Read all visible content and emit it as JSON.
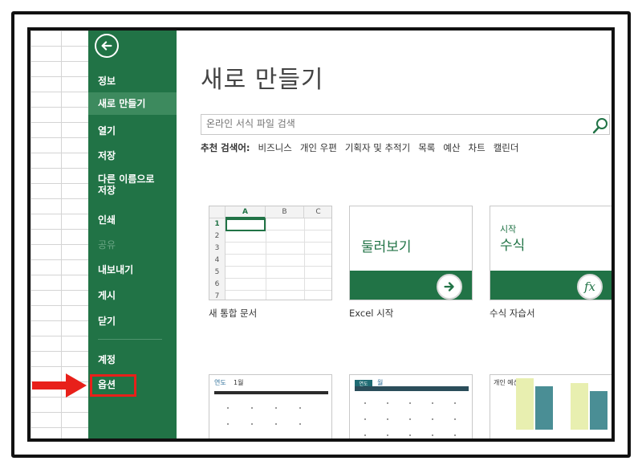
{
  "sidebar": {
    "back_icon": "arrow-left-circle-icon",
    "items": [
      {
        "label": "정보"
      },
      {
        "label": "새로 만들기"
      },
      {
        "label": "열기"
      },
      {
        "label": "저장"
      },
      {
        "label": "다른 이름으로 저장"
      },
      {
        "label": "인쇄"
      },
      {
        "label": "공유"
      },
      {
        "label": "내보내기"
      },
      {
        "label": "게시"
      },
      {
        "label": "닫기"
      },
      {
        "label": "계정"
      },
      {
        "label": "옵션"
      }
    ],
    "active_item": "새로 만들기",
    "disabled_item": "공유",
    "highlighted_item": "옵션",
    "color": "#217346"
  },
  "main": {
    "title": "새로 만들기",
    "search": {
      "placeholder": "온라인 서식 파일 검색",
      "icon": "search-icon"
    },
    "suggested_label": "추천 검색어:",
    "suggested": [
      "비즈니스",
      "개인 우편",
      "기획자 및 추적기",
      "목록",
      "예산",
      "차트",
      "캘린더"
    ],
    "templates": [
      {
        "caption": "새 통합 문서",
        "columns": [
          "A",
          "B",
          "C"
        ],
        "rows": [
          "1",
          "2",
          "3",
          "4",
          "5",
          "6",
          "7"
        ]
      },
      {
        "caption": "Excel 시작",
        "tile_text": "둘러보기",
        "icon": "arrow-right-icon"
      },
      {
        "caption": "수식 자습서",
        "tile_small": "시작",
        "tile_text": "수식",
        "icon": "fx-icon",
        "fx": "fx"
      }
    ],
    "bottom_templates": [
      {
        "label_a": "연도",
        "label_b": "1월"
      },
      {
        "badge": "연도",
        "label_b": "월"
      },
      {
        "label_a": "개인 예산"
      }
    ]
  },
  "annotation": {
    "color": "#e8201a",
    "arrow_icon": "red-arrow-icon"
  }
}
